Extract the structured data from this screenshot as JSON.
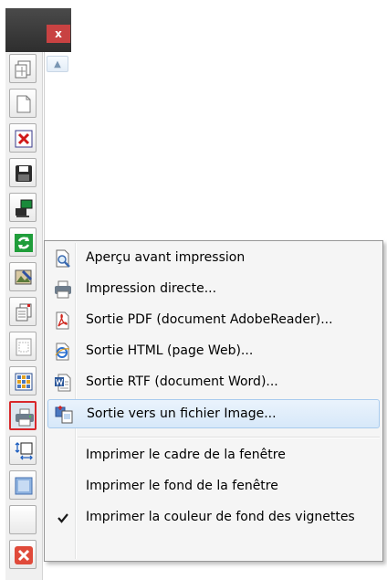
{
  "window": {
    "close_glyph": "x"
  },
  "toolbar": {
    "buttons": [
      {
        "name": "new-window-button",
        "icon": "window-pages-icon"
      },
      {
        "name": "new-document-button",
        "icon": "blank-page-icon"
      },
      {
        "name": "delete-button",
        "icon": "red-x-icon"
      },
      {
        "name": "save-button",
        "icon": "floppy-disk-icon"
      },
      {
        "name": "computer-button",
        "icon": "computer-icon"
      },
      {
        "name": "refresh-button",
        "icon": "green-refresh-icon"
      },
      {
        "name": "edit-image-button",
        "icon": "image-edit-icon"
      },
      {
        "name": "copy-pages-button",
        "icon": "stacked-pages-icon"
      },
      {
        "name": "page-frame-button",
        "icon": "page-frame-icon"
      },
      {
        "name": "grid-view-button",
        "icon": "grid-icon"
      },
      {
        "name": "print-button",
        "icon": "printer-icon",
        "active": true
      },
      {
        "name": "resize-button",
        "icon": "resize-icon"
      },
      {
        "name": "image-button",
        "icon": "picture-icon"
      },
      {
        "name": "empty-button",
        "icon": ""
      },
      {
        "name": "quit-button",
        "icon": "red-close-icon"
      }
    ]
  },
  "menu": {
    "items": [
      {
        "label": "Aperçu avant impression",
        "icon": "print-preview-icon"
      },
      {
        "label": "Impression directe...",
        "icon": "printer-icon"
      },
      {
        "label": "Sortie PDF (document AdobeReader)...",
        "icon": "pdf-icon"
      },
      {
        "label": "Sortie HTML (page Web)...",
        "icon": "html-icon"
      },
      {
        "label": "Sortie RTF (document Word)...",
        "icon": "word-icon"
      },
      {
        "label": "Sortie vers un fichier Image...",
        "icon": "image-file-icon",
        "highlighted": true
      },
      {
        "label": "Imprimer le cadre de la fenêtre",
        "icon": ""
      },
      {
        "label": "Imprimer le fond de la fenêtre",
        "icon": ""
      },
      {
        "label": "Imprimer la couleur de fond des vignettes",
        "icon": "checkmark-icon",
        "checked": true
      }
    ]
  },
  "colors": {
    "active_border": "#d9282b",
    "highlight_bg": "#d7e8f9",
    "highlight_border": "#a8cbee"
  }
}
